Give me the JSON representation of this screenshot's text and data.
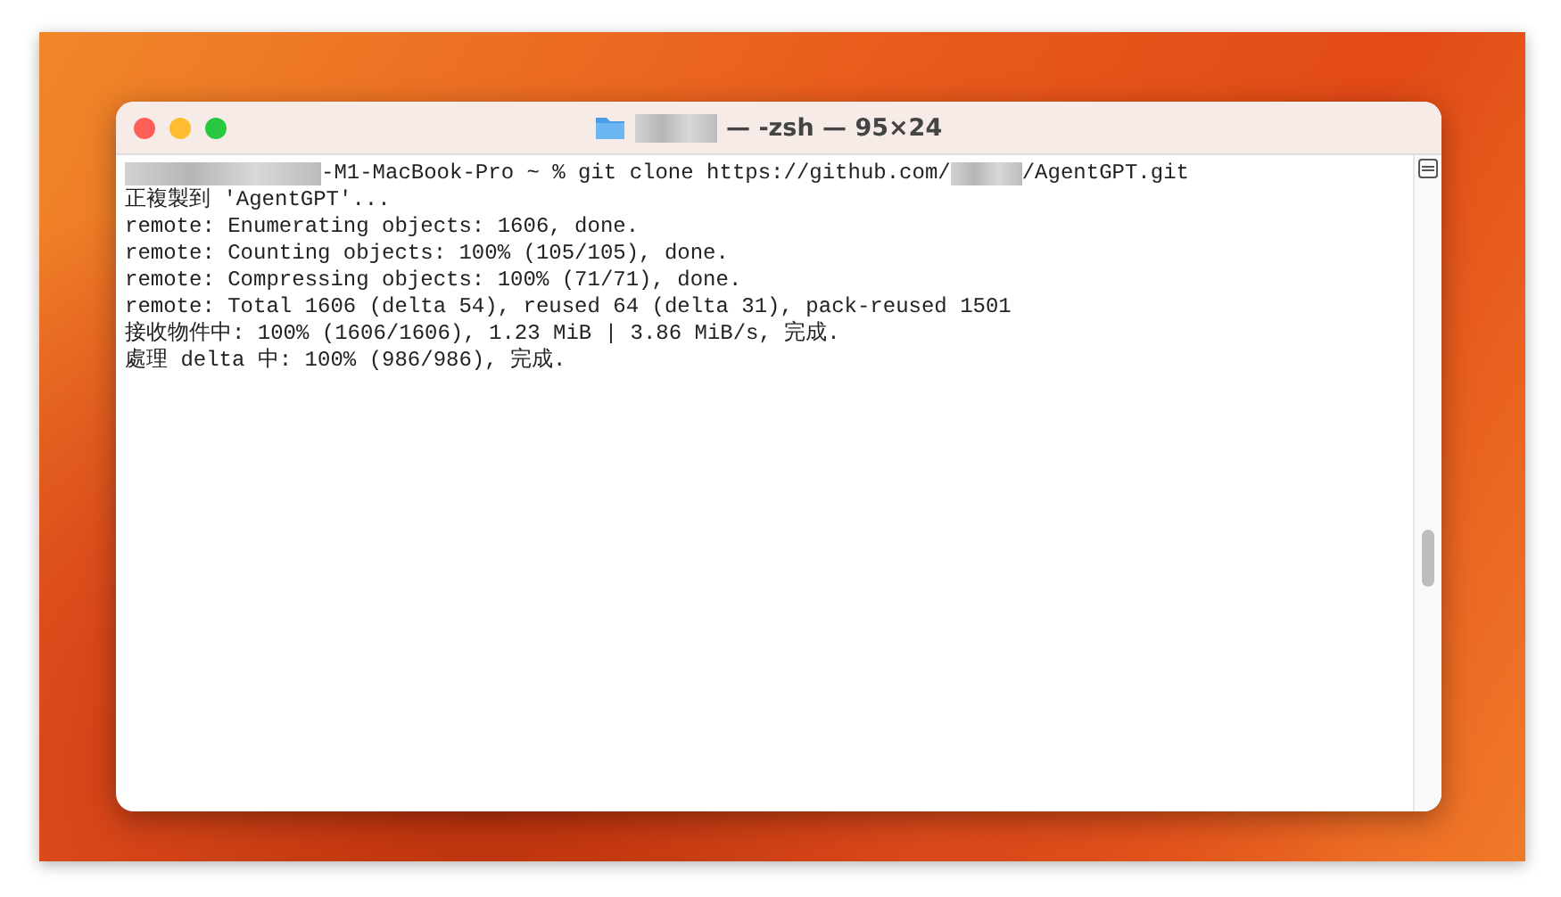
{
  "window": {
    "title_parts": [
      {
        "kind": "redacted"
      },
      {
        "kind": "text",
        "text": "— -zsh — 95×24"
      }
    ]
  },
  "terminal": {
    "lines": [
      {
        "parts": [
          {
            "kind": "redacted"
          },
          {
            "kind": "text",
            "text": "-M1-MacBook-Pro ~ % git clone https://github.com/"
          },
          {
            "kind": "redacted"
          },
          {
            "kind": "text",
            "text": "/AgentGPT.git"
          }
        ]
      },
      {
        "parts": [
          {
            "kind": "text",
            "text": "正複製到 'AgentGPT'..."
          }
        ]
      },
      {
        "parts": [
          {
            "kind": "text",
            "text": "remote: Enumerating objects: 1606, done."
          }
        ]
      },
      {
        "parts": [
          {
            "kind": "text",
            "text": "remote: Counting objects: 100% (105/105), done."
          }
        ]
      },
      {
        "parts": [
          {
            "kind": "text",
            "text": "remote: Compressing objects: 100% (71/71), done."
          }
        ]
      },
      {
        "parts": [
          {
            "kind": "text",
            "text": "remote: Total 1606 (delta 54), reused 64 (delta 31), pack-reused 1501"
          }
        ]
      },
      {
        "parts": [
          {
            "kind": "text",
            "text": "接收物件中: 100% (1606/1606), 1.23 MiB | 3.86 MiB/s, 完成."
          }
        ]
      },
      {
        "parts": [
          {
            "kind": "text",
            "text": "處理 delta 中: 100% (986/986), 完成."
          }
        ]
      }
    ]
  }
}
